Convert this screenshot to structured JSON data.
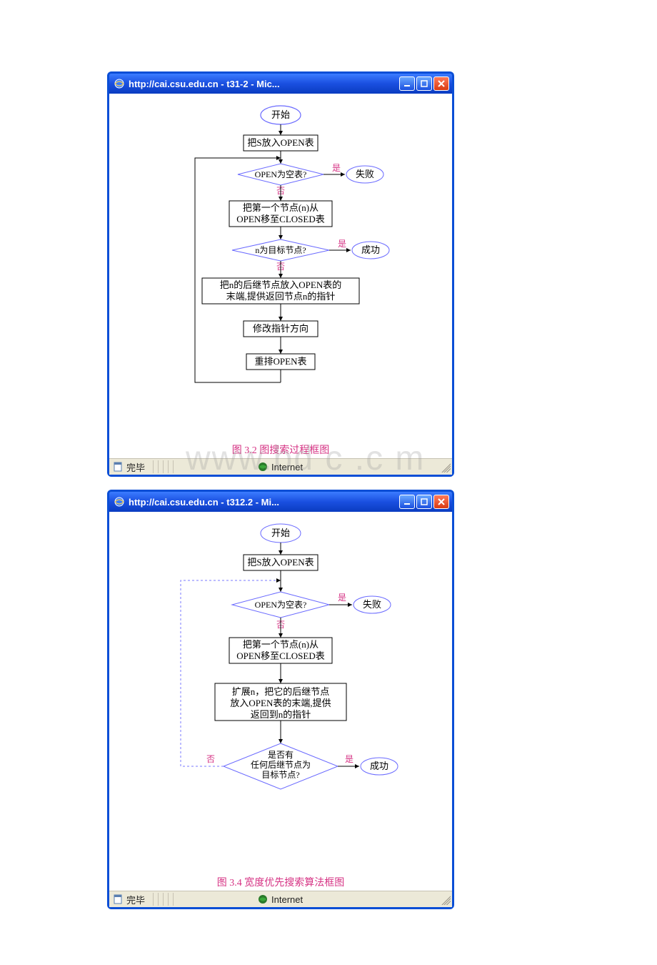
{
  "watermark": "www.bd c .c m",
  "window1": {
    "title": "http://cai.csu.edu.cn - t31-2 - Mic...",
    "status_left": "完毕",
    "status_zone": "Internet",
    "caption": "图 3.2  图搜索过程框图",
    "flow": {
      "start": "开始",
      "step1": "把S放入OPEN表",
      "decision1": "OPEN为空表?",
      "yes": "是",
      "no": "否",
      "fail": "失败",
      "step2_l1": "把第一个节点(n)从",
      "step2_l2": "OPEN移至CLOSED表",
      "decision2": "n为目标节点?",
      "success": "成功",
      "step3_l1": "把n的后继节点放入OPEN表的",
      "step3_l2": "末端,提供返回节点n的指针",
      "step4": "修改指针方向",
      "step5": "重排OPEN表"
    }
  },
  "window2": {
    "title": "http://cai.csu.edu.cn - t312.2 - Mi...",
    "status_left": "完毕",
    "status_zone": "Internet",
    "caption": "图 3.4  宽度优先搜索算法框图",
    "flow": {
      "start": "开始",
      "step1": "把S放入OPEN表",
      "decision1": "OPEN为空表?",
      "yes": "是",
      "no": "否",
      "fail": "失败",
      "step2_l1": "把第一个节点(n)从",
      "step2_l2": "OPEN移至CLOSED表",
      "step3_l1": "扩展n，把它的后继节点",
      "step3_l2": "放入OPEN表的末端,提供",
      "step3_l3": "返回到n的指针",
      "decision2_l1": "是否有",
      "decision2_l2": "任何后继节点为",
      "decision2_l3": "目标节点?",
      "success": "成功"
    }
  }
}
